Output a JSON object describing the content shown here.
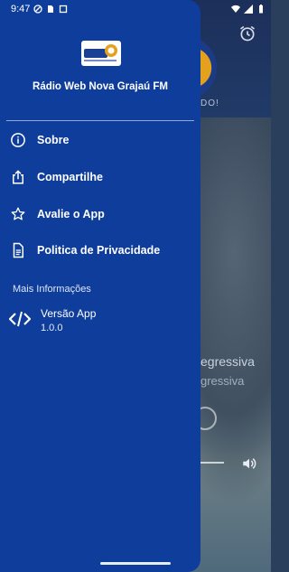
{
  "status_bar": {
    "time": "9:47"
  },
  "drawer": {
    "station_name": "Rádio Web Nova Grajaú FM",
    "menu": [
      {
        "label": "Sobre",
        "icon": "info-icon"
      },
      {
        "label": "Compartilhe",
        "icon": "share-icon"
      },
      {
        "label": "Avalie o App",
        "icon": "star-icon"
      },
      {
        "label": "Politica de Privacidade",
        "icon": "document-icon"
      }
    ],
    "section_title": "Mais Informações",
    "version": {
      "label": "Versão App",
      "value": "1.0.0",
      "icon": "code-icon"
    }
  },
  "background": {
    "tagline_partial": "DO!",
    "title_partial": "egressiva",
    "subtitle_partial": "gressiva"
  },
  "colors": {
    "drawer": "#0f3d9c",
    "accent": "#e4a11d"
  }
}
